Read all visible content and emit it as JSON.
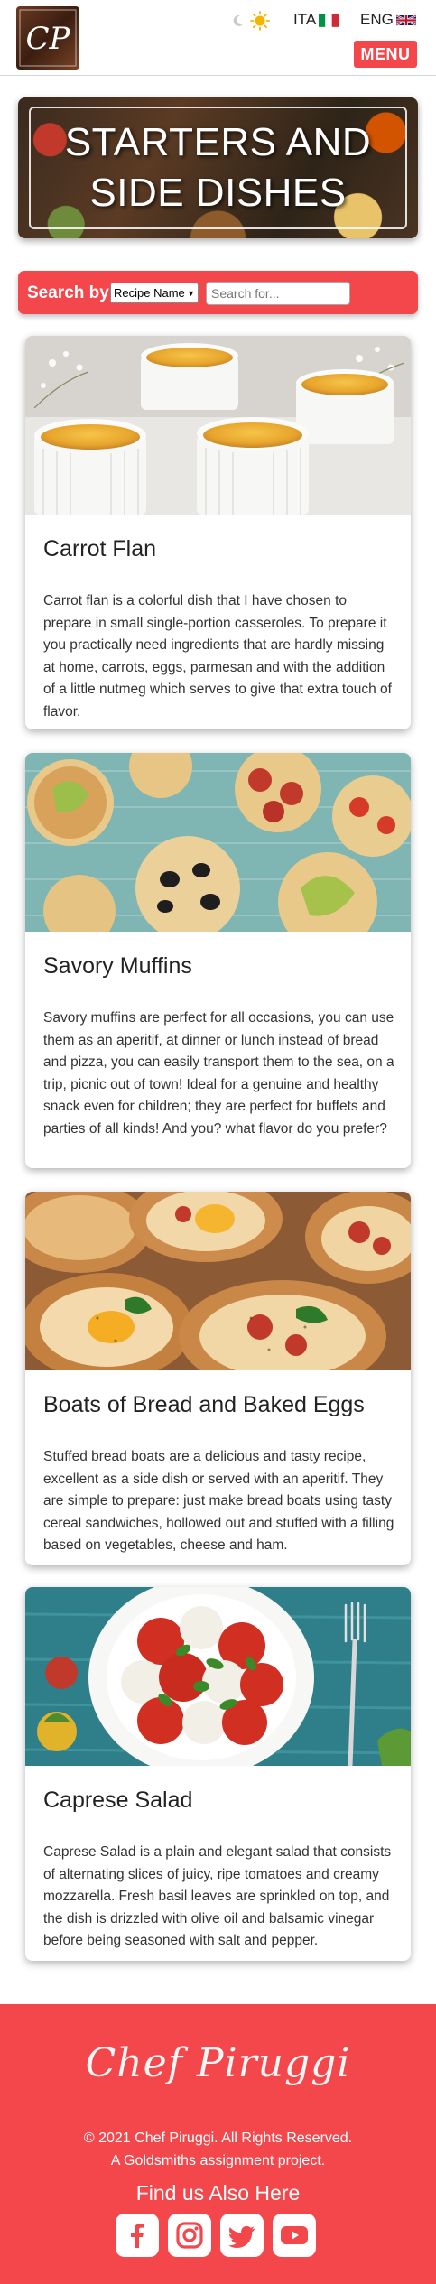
{
  "header": {
    "logo_text": "CP",
    "lang_it": "ITA",
    "lang_en": "ENG",
    "menu_label": "MENU"
  },
  "hero": {
    "title_line1": "STARTERS AND",
    "title_line2": "SIDE DISHES"
  },
  "search": {
    "label": "Search by",
    "selected_option": "Recipe Name",
    "placeholder": "Search for..."
  },
  "recipes": [
    {
      "title": "Carrot Flan",
      "description": "Carrot flan is a colorful dish that I have chosen to prepare in small single-portion casseroles. To prepare it you practically need ingredients that are hardly missing at home, carrots, eggs, parmesan and with the addition of a little nutmeg which serves to give that extra touch of flavor."
    },
    {
      "title": "Savory Muffins",
      "description": "Savory muffins are perfect for all occasions, you can use them as an aperitif, at dinner or lunch instead of bread and pizza, you can easily transport them to the sea, on a trip, picnic out of town! Ideal for a genuine and healthy snack even for children; they are perfect for buffets and parties of all kinds! And you? what flavor do you prefer?"
    },
    {
      "title": "Boats of Bread and Baked Eggs",
      "description": "Stuffed bread boats are a delicious and tasty recipe, excellent as a side dish or served with an aperitif. They are simple to prepare: just make bread boats using tasty cereal sandwiches, hollowed out and stuffed with a filling based on vegetables, cheese and ham."
    },
    {
      "title": "Caprese Salad",
      "description": "Caprese Salad is a plain and elegant salad that consists of alternating slices of juicy, ripe tomatoes and creamy mozzarella. Fresh basil leaves are sprinkled on top, and the dish is drizzled with olive oil and balsamic vinegar before being seasoned with salt and pepper."
    }
  ],
  "footer": {
    "signature": "Chef Piruggi",
    "copyright_line1": "© 2021 Chef Piruggi. All Rights Reserved.",
    "copyright_line2": "A Goldsmiths assignment project.",
    "find_us": "Find us Also Here",
    "socials": [
      "facebook-icon",
      "instagram-icon",
      "twitter-icon",
      "youtube-icon"
    ]
  },
  "colors": {
    "accent": "#f4474c",
    "footer_bg": "#f4474c"
  }
}
